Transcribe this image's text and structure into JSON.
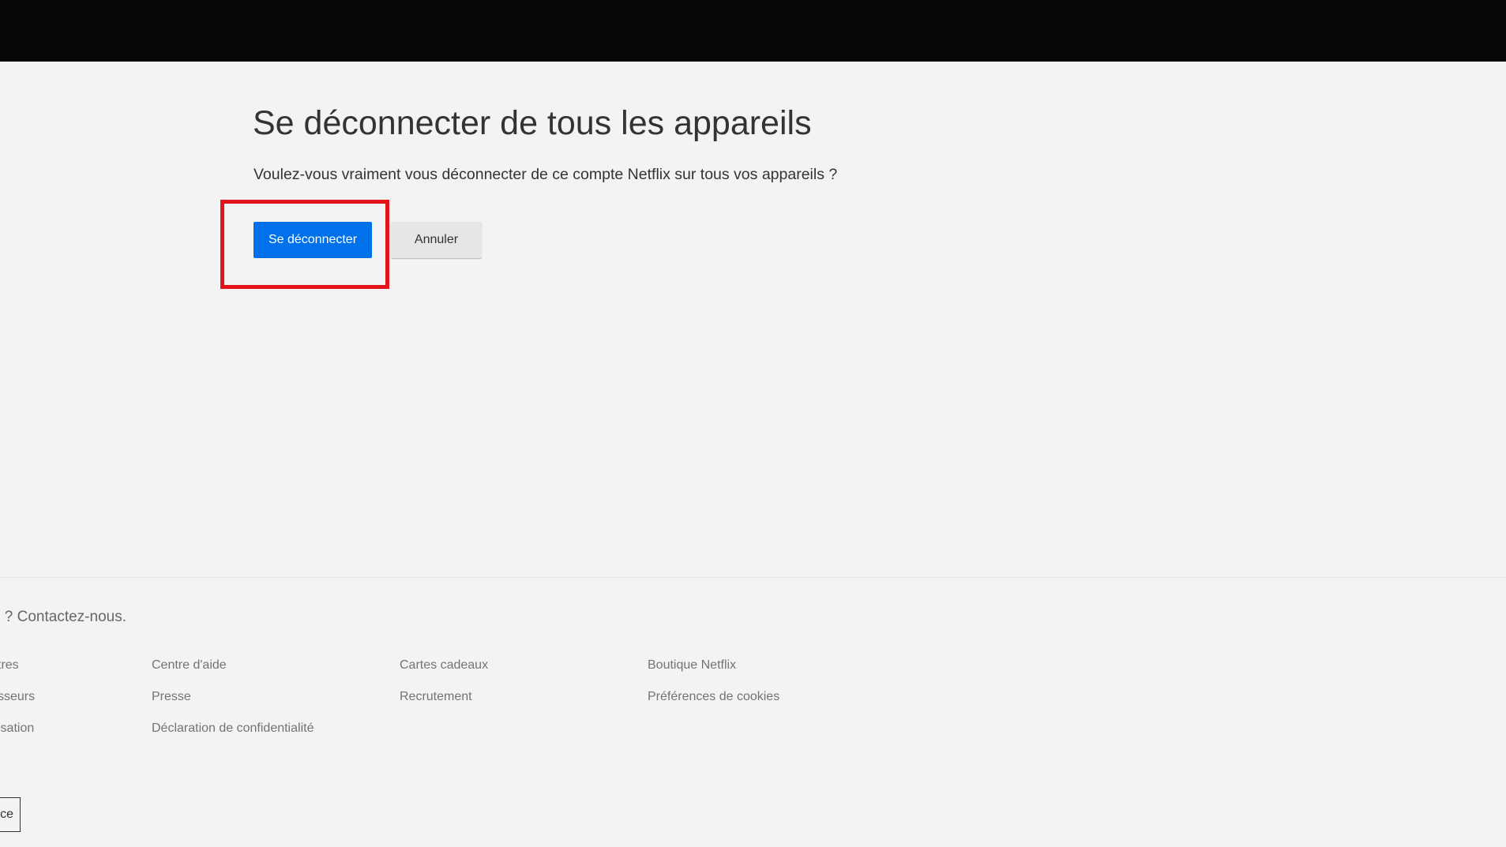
{
  "header": {},
  "main": {
    "title": "Se déconnecter de tous les appareils",
    "message": "Voulez-vous vraiment vous déconnecter de ce compte Netflix sur tous vos appareils ?",
    "signout_button": "Se déconnecter",
    "cancel_button": "Annuler",
    "highlight_color": "#e4141c",
    "primary_color": "#0071eb"
  },
  "footer": {
    "contact": "s ? Contactez-nous.",
    "links": [
      "tres",
      "Centre d'aide",
      "Cartes cadeaux",
      "Boutique Netflix",
      "sseurs",
      "Presse",
      "Recrutement",
      "Préférences de cookies",
      "isation",
      "Déclaration de confidentialité"
    ],
    "language": "ce"
  }
}
